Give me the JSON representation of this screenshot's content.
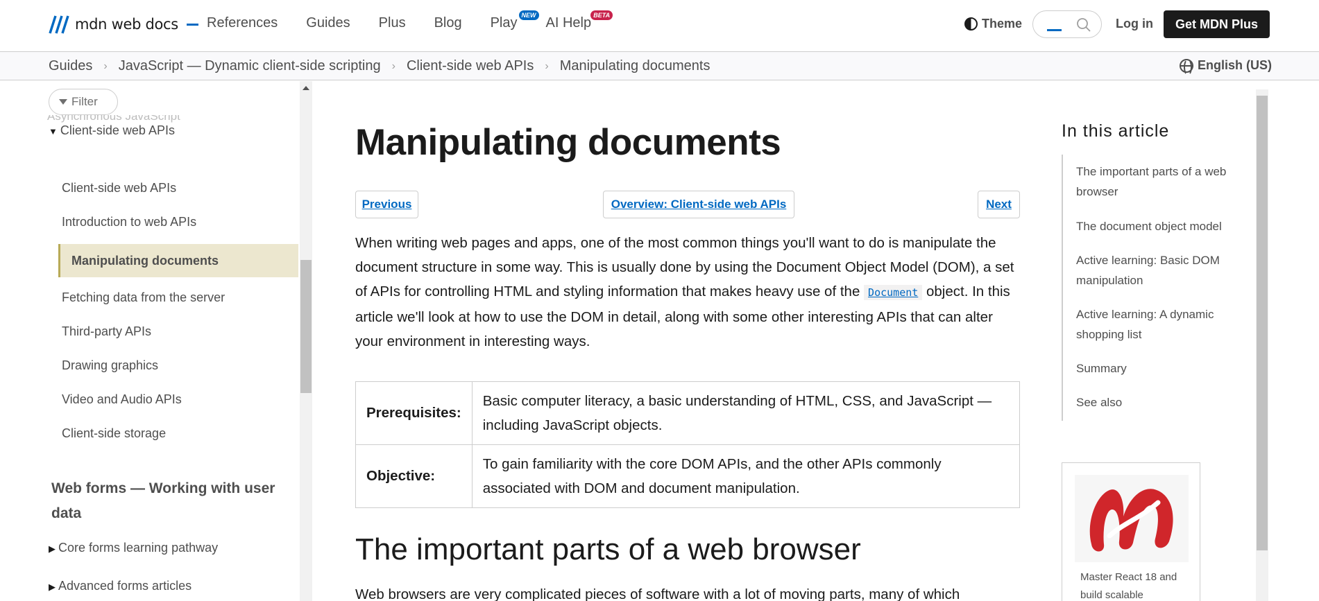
{
  "header": {
    "logo_text": "mdn web docs",
    "nav": [
      {
        "label": "References"
      },
      {
        "label": "Guides"
      },
      {
        "label": "Plus"
      },
      {
        "label": "Blog"
      },
      {
        "label": "Play",
        "badge": "NEW"
      },
      {
        "label": "AI Help",
        "badge": "BETA"
      }
    ],
    "theme_label": "Theme",
    "login_label": "Log in",
    "cta_label": "Get MDN Plus"
  },
  "breadcrumb": {
    "items": [
      "Guides",
      "JavaScript — Dynamic client-side scripting",
      "Client-side web APIs",
      "Manipulating documents"
    ],
    "language": "English (US)"
  },
  "sidebar": {
    "filter_label": "Filter",
    "faded_item": "Asynchronous JavaScript",
    "section_label": "Client-side web APIs",
    "items": [
      "Client-side web APIs",
      "Introduction to web APIs",
      "Manipulating documents",
      "Fetching data from the server",
      "Third-party APIs",
      "Drawing graphics",
      "Video and Audio APIs",
      "Client-side storage"
    ],
    "heading": "Web forms — Working with user data",
    "sub_items": [
      "Core forms learning pathway",
      "Advanced forms articles"
    ]
  },
  "article": {
    "title": "Manipulating documents",
    "prev_label": "Previous",
    "overview_label": "Overview: Client-side web APIs",
    "next_label": "Next",
    "intro_part1": "When writing web pages and apps, one of the most common things you'll want to do is manipulate the document structure in some way. This is usually done by using the Document Object Model (DOM), a set of APIs for controlling HTML and styling information that makes heavy use of the ",
    "intro_code": "Document",
    "intro_part2": " object. In this article we'll look at how to use the DOM in detail, along with some other interesting APIs that can alter your environment in interesting ways.",
    "table": [
      {
        "label": "Prerequisites:",
        "value": "Basic computer literacy, a basic understanding of HTML, CSS, and JavaScript — including JavaScript objects."
      },
      {
        "label": "Objective:",
        "value": "To gain familiarity with the core DOM APIs, and the other APIs commonly associated with DOM and document manipulation."
      }
    ],
    "h2": "The important parts of a web browser",
    "para2": "Web browsers are very complicated pieces of software with a lot of moving parts, many of which"
  },
  "toc": {
    "title": "In this article",
    "items": [
      "The important parts of a web browser",
      "The document object model",
      "Active learning: Basic DOM manipulation",
      "Active learning: A dynamic shopping list",
      "Summary",
      "See also"
    ]
  },
  "ad": {
    "text": "Master React 18 and build scalable"
  },
  "colors": {
    "link": "#0069c2",
    "active_bg": "#ece7cf",
    "badge_new": "#0069c2",
    "badge_beta": "#c8234c",
    "ad_logo": "#d0262b"
  }
}
